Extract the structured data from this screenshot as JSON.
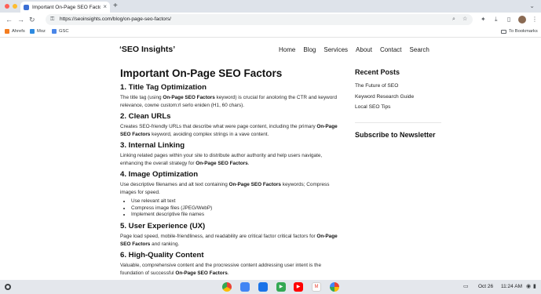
{
  "browser": {
    "tab_title": "Important On-Page SEO Factors",
    "tab_close": "×",
    "new_tab": "+",
    "url": "https://seoinsights.com/blog/on-page-seo-factors/",
    "bookmarks": [
      "Ahrefs",
      "Moz",
      "GSC"
    ],
    "bookmark_colors": [
      "#f47d20",
      "#2d8ae0",
      "#4a86e8"
    ],
    "bookmarks_folder": "To Bookmarks",
    "icons": [
      "back-icon",
      "forward-icon",
      "reload-icon",
      "lock-icon",
      "zoom-icon",
      "star-icon",
      "extensions-icon",
      "sidebar-icon",
      "menu-icon"
    ]
  },
  "site": {
    "logo": "‘SEO Insights’",
    "nav": [
      "Home",
      "Blog",
      "Services",
      "About",
      "Contact",
      "Search"
    ]
  },
  "article": {
    "title": "Important On-Page SEO Factors",
    "sections": [
      {
        "heading": "1. Title Tag Optimization",
        "p_pre": "The title tag (using ",
        "p_bold": "On-Page SEO Factors",
        "p_post": " keyword) is crucial for anoloring the CTR and keyword relevance, cowne custom:rl serlo eniden (H1, 60 chars)."
      },
      {
        "heading": "2. Clean URLs",
        "p_pre": "Creates SEO-friendly URLs that describe what were page content, including the primary ",
        "p_bold": "On-Page SEO Factors",
        "p_post": " keyword, avoiding complex strings in a vave content."
      },
      {
        "heading": "3. Internal Linking",
        "p_pre": "Linking related pages within your site to distribute author authority and help users navigate, enhancing the overall strategy for ",
        "p_bold": "On-Page SEO Factors",
        "p_post": "."
      },
      {
        "heading": "4. Image Optimization",
        "p_pre": "Use descriptive filenames and alt text containing ",
        "p_bold": "On-Page SEO Factors",
        "p_post": " keywords; Compress images for speed.",
        "bullets": [
          "Use relevant alt text",
          "Compress image files (JPEG/WebP)",
          "Implement descriptive file names"
        ]
      },
      {
        "heading": "5. User Experience (UX)",
        "p_pre": "Page load speed, mobile-friendliness, and readability are critical factor critical factors for ",
        "p_bold": "On-Page SEO Factors",
        "p_post": " and ranking."
      },
      {
        "heading": "6. High-Quality Content",
        "p_pre": "Valuable, comprehensive content and the procressive content addressing user intent is the foundation of successful ",
        "p_bold": "On-Page SEO Factors",
        "p_post": "."
      }
    ]
  },
  "sidebar": {
    "recent_title": "Recent Posts",
    "recent": [
      "The Future of SEO",
      "Keyword Research Guide",
      "Local SEO Tips"
    ],
    "subscribe_title": "Subscribe to Newsletter"
  },
  "shelf": {
    "date": "Oct 26",
    "time": "11:24 AM",
    "apps": [
      "chrome-icon",
      "files-icon",
      "docs-icon",
      "calendar-icon",
      "play-store-icon",
      "youtube-icon",
      "gmail-icon",
      "photos-icon"
    ]
  }
}
